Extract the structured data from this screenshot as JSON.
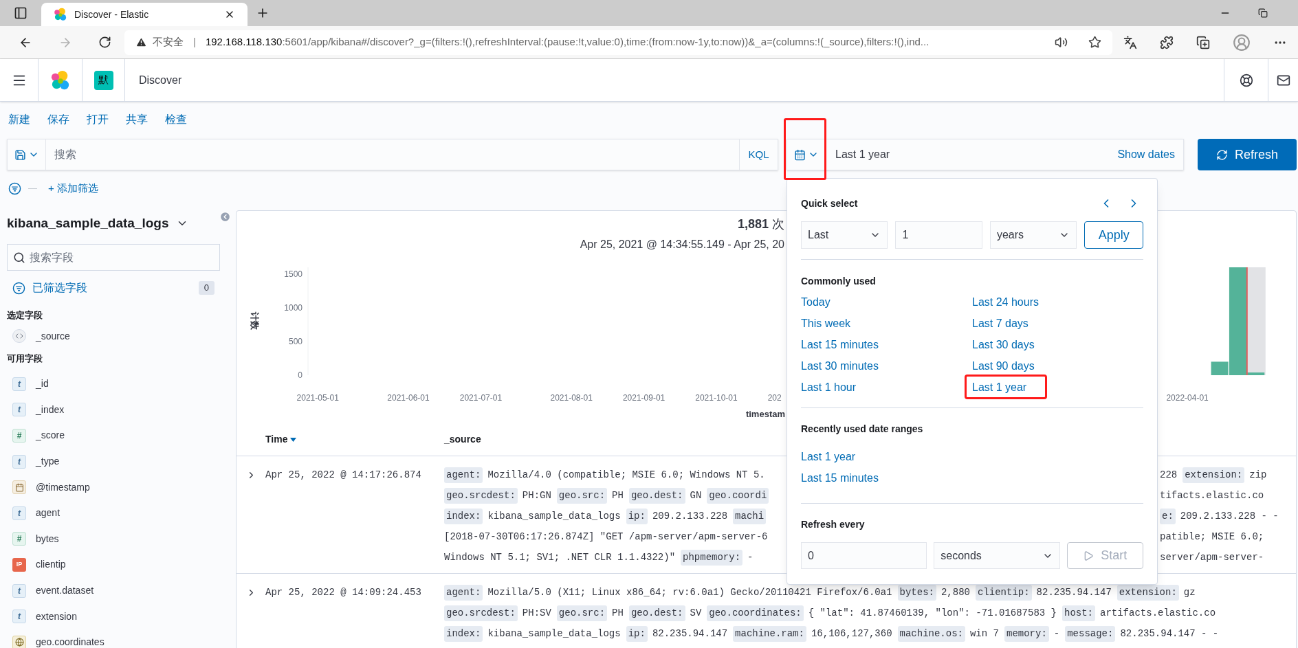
{
  "browser": {
    "tab_title": "Discover - Elastic",
    "back": {
      "disabled": false
    },
    "forward": {
      "disabled": true
    },
    "security": "不安全",
    "separator": "|",
    "host": "192.168.118.130",
    "path": ":5601/app/kibana#/discover?_g=(filters:!(),refreshInterval:(pause:!t,value:0),time:(from:now-1y,to:now))&_a=(columns:!(_source),filters:!(),ind..."
  },
  "header": {
    "space_avatar": "默",
    "app_title": "Discover"
  },
  "top_nav": [
    "新建",
    "保存",
    "打开",
    "共享",
    "检查"
  ],
  "query_bar": {
    "placeholder": "搜索",
    "language": "KQL"
  },
  "date_picker": {
    "value": "Last 1 year",
    "show_dates": "Show dates",
    "refresh": "Refresh"
  },
  "filter_bar": {
    "separator": "—",
    "add_filter": "+ 添加筛选"
  },
  "sidebar": {
    "index_pattern": "kibana_sample_data_logs",
    "search_placeholder": "搜索字段",
    "filtered_label": "已筛选字段",
    "filtered_count": "0",
    "selected_heading": "选定字段",
    "selected_fields": [
      {
        "name": "_source",
        "kind": "source"
      }
    ],
    "available_heading": "可用字段",
    "available_fields": [
      {
        "name": "_id",
        "kind": "string",
        "token": "t"
      },
      {
        "name": "_index",
        "kind": "string",
        "token": "t"
      },
      {
        "name": "_score",
        "kind": "number",
        "token": "#"
      },
      {
        "name": "_type",
        "kind": "string",
        "token": "t"
      },
      {
        "name": "@timestamp",
        "kind": "date"
      },
      {
        "name": "agent",
        "kind": "string",
        "token": "t"
      },
      {
        "name": "bytes",
        "kind": "number",
        "token": "#"
      },
      {
        "name": "clientip",
        "kind": "ip",
        "token": "IP"
      },
      {
        "name": "event.dataset",
        "kind": "string",
        "token": "t"
      },
      {
        "name": "extension",
        "kind": "string",
        "token": "t"
      },
      {
        "name": "geo.coordinates",
        "kind": "geo"
      }
    ]
  },
  "chart": {
    "hits": "**1,881** 次",
    "range": "Apr 25, 2021 @ 14:34:55.149 - Apr 25, 20",
    "chart_data": {
      "type": "bar",
      "xlabel": "timestam",
      "ylabel": "计数",
      "categories": [
        "2021-05-01",
        null,
        null,
        null,
        null,
        "2021-06-01",
        null,
        null,
        null,
        "2021-07-01",
        null,
        null,
        null,
        null,
        "2021-08-01",
        null,
        null,
        null,
        "2021-09-01",
        null,
        null,
        null,
        "2021-10-01",
        null,
        null,
        null,
        "202",
        null,
        null,
        null,
        null,
        null,
        null,
        null,
        null,
        null,
        null,
        null,
        null,
        null,
        null,
        null,
        null,
        null,
        null,
        null,
        null,
        null,
        "2022-04-01",
        null,
        null,
        null,
        null,
        null
      ],
      "series": [
        {
          "color": "#54b399",
          "values": [
            null,
            null,
            null,
            null,
            null,
            null,
            null,
            null,
            null,
            null,
            null,
            null,
            null,
            null,
            null,
            null,
            null,
            null,
            null,
            null,
            null,
            null,
            null,
            null,
            null,
            null,
            null,
            null,
            null,
            null,
            null,
            null,
            null,
            null,
            null,
            null,
            null,
            null,
            null,
            null,
            null,
            null,
            null,
            null,
            null,
            null,
            null,
            null,
            null,
            null,
            200,
            1600,
            40,
            null
          ]
        }
      ],
      "ylim": [
        0,
        1600
      ],
      "yticks": [
        0,
        500,
        1000,
        1500
      ]
    }
  },
  "table": {
    "columns": [
      {
        "label": "Time",
        "sorted_desc": true
      },
      {
        "label": "_source",
        "sorted_desc": false
      }
    ],
    "rows": [
      {
        "time": "Apr 25, 2022 @ 14:17:26.874",
        "lines": [
          {
            "left": [
              {
                "kind": "key",
                "text": "agent:"
              },
              {
                "kind": "value",
                "text": "Mozilla/4.0 (compatible; MSIE 6.0; Windows NT 5."
              }
            ],
            "right": [
              {
                "kind": "value",
                "text": "228"
              },
              {
                "kind": "key",
                "text": "extension:"
              },
              {
                "kind": "value",
                "text": "zip"
              }
            ]
          },
          {
            "left": [
              {
                "kind": "key",
                "text": "geo.srcdest:"
              },
              {
                "kind": "value",
                "text": "PH:GN"
              },
              {
                "kind": "key",
                "text": "geo.src:"
              },
              {
                "kind": "value",
                "text": "PH"
              },
              {
                "kind": "key",
                "text": "geo.dest:"
              },
              {
                "kind": "value",
                "text": "GN"
              },
              {
                "kind": "key",
                "text": "geo.coordi"
              }
            ],
            "right": [
              {
                "kind": "value",
                "text": "tifacts.elastic.co"
              }
            ]
          },
          {
            "left": [
              {
                "kind": "key",
                "text": "index:"
              },
              {
                "kind": "value",
                "text": "kibana_sample_data_logs"
              },
              {
                "kind": "key",
                "text": "ip:"
              },
              {
                "kind": "value",
                "text": "209.2.133.228"
              },
              {
                "kind": "key",
                "text": "machi"
              }
            ],
            "right": [
              {
                "kind": "key",
                "text": "e:"
              },
              {
                "kind": "value",
                "text": "209.2.133.228 - -"
              }
            ]
          },
          {
            "left": [
              {
                "kind": "value",
                "text": "[2018-07-30T06:17:26.874Z] \"GET /apm-server/apm-server-6"
              }
            ],
            "right": [
              {
                "kind": "value",
                "text": "patible; MSIE 6.0;"
              }
            ]
          },
          {
            "left": [
              {
                "kind": "value",
                "text": "Windows NT 5.1; SV1; .NET CLR 1.1.4322)\""
              },
              {
                "kind": "key",
                "text": "phpmemory:"
              },
              {
                "kind": "value",
                "text": "-"
              }
            ],
            "right": [
              {
                "kind": "value",
                "text": "server/apm-server-"
              }
            ]
          }
        ]
      },
      {
        "time": "Apr 25, 2022 @ 14:09:24.453",
        "lines": [
          {
            "left": [
              {
                "kind": "key",
                "text": "agent:"
              },
              {
                "kind": "value",
                "text": "Mozilla/5.0 (X11; Linux x86_64; rv:6.0a1) Gecko/20110421 Firefox/6.0a1"
              },
              {
                "kind": "key",
                "text": "bytes:"
              },
              {
                "kind": "value",
                "text": "2,880"
              },
              {
                "kind": "key",
                "text": "clientip:"
              },
              {
                "kind": "value",
                "text": "82.235.94.147"
              },
              {
                "kind": "key",
                "text": "extension:"
              },
              {
                "kind": "value",
                "text": "gz"
              }
            ]
          },
          {
            "left": [
              {
                "kind": "key",
                "text": "geo.srcdest:"
              },
              {
                "kind": "value",
                "text": "PH:SV"
              },
              {
                "kind": "key",
                "text": "geo.src:"
              },
              {
                "kind": "value",
                "text": "PH"
              },
              {
                "kind": "key",
                "text": "geo.dest:"
              },
              {
                "kind": "value",
                "text": "SV"
              },
              {
                "kind": "key",
                "text": "geo.coordinates:"
              },
              {
                "kind": "value",
                "text": "{ \"lat\": 41.87460139, \"lon\": -71.01687583 }"
              },
              {
                "kind": "key",
                "text": "host:"
              },
              {
                "kind": "value",
                "text": "artifacts.elastic.co"
              }
            ]
          },
          {
            "left": [
              {
                "kind": "key",
                "text": "index:"
              },
              {
                "kind": "value",
                "text": "kibana_sample_data_logs"
              },
              {
                "kind": "key",
                "text": "ip:"
              },
              {
                "kind": "value",
                "text": "82.235.94.147"
              },
              {
                "kind": "key",
                "text": "machine.ram:"
              },
              {
                "kind": "value",
                "text": "16,106,127,360"
              },
              {
                "kind": "key",
                "text": "machine.os:"
              },
              {
                "kind": "value",
                "text": "win 7"
              },
              {
                "kind": "key",
                "text": "memory:"
              },
              {
                "kind": "value",
                "text": "-"
              },
              {
                "kind": "key",
                "text": "message:"
              },
              {
                "kind": "value",
                "text": "82.235.94.147 - -"
              }
            ]
          }
        ]
      }
    ]
  },
  "quick_menu": {
    "quick_select": {
      "title": "Quick select",
      "direction": "Last",
      "amount": "1",
      "unit": "years",
      "apply": "Apply"
    },
    "commonly_used": {
      "title": "Commonly used",
      "items": [
        "Today",
        "This week",
        "Last 15 minutes",
        "Last 30 minutes",
        "Last 1 hour",
        "Last 24 hours",
        "Last 7 days",
        "Last 30 days",
        "Last 90 days",
        "Last 1 year"
      ]
    },
    "recently_used": {
      "title": "Recently used date ranges",
      "items": [
        "Last 1 year",
        "Last 15 minutes"
      ]
    },
    "refresh": {
      "title": "Refresh every",
      "interval": "0",
      "unit": "seconds",
      "start": "Start",
      "start_disabled": true
    }
  }
}
